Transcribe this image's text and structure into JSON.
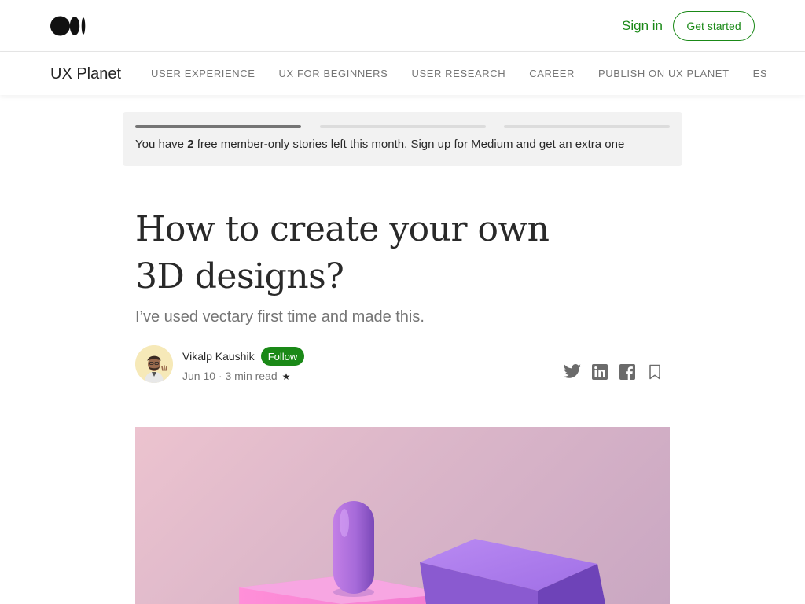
{
  "header": {
    "logo_icon": "medium-logo-icon",
    "sign_in_label": "Sign in",
    "get_started_label": "Get started"
  },
  "publication": {
    "name": "UX Planet",
    "nav_items": [
      "USER EXPERIENCE",
      "UX FOR BEGINNERS",
      "USER RESEARCH",
      "CAREER",
      "PUBLISH ON UX PLANET",
      "ES"
    ]
  },
  "meter": {
    "prefix": "You have ",
    "count": "2",
    "suffix": " free member-only stories left this month. ",
    "link": "Sign up for Medium and get an extra one",
    "progress_filled": 1,
    "progress_total": 3
  },
  "article": {
    "title": "How to create your own 3D designs?",
    "subtitle": "I’ve used vectary first time and made this.",
    "author": "Vikalp Kaushik",
    "follow_label": "Follow",
    "date": "Jun 10",
    "separator": " · ",
    "read_time": "3 min read",
    "member_star": "★"
  },
  "share_icons": [
    "twitter-icon",
    "linkedin-icon",
    "facebook-icon",
    "bookmark-icon"
  ],
  "colors": {
    "accent": "#1a8917",
    "text": "#292929",
    "muted": "#757575",
    "banner_bg": "#f2f2f2"
  }
}
